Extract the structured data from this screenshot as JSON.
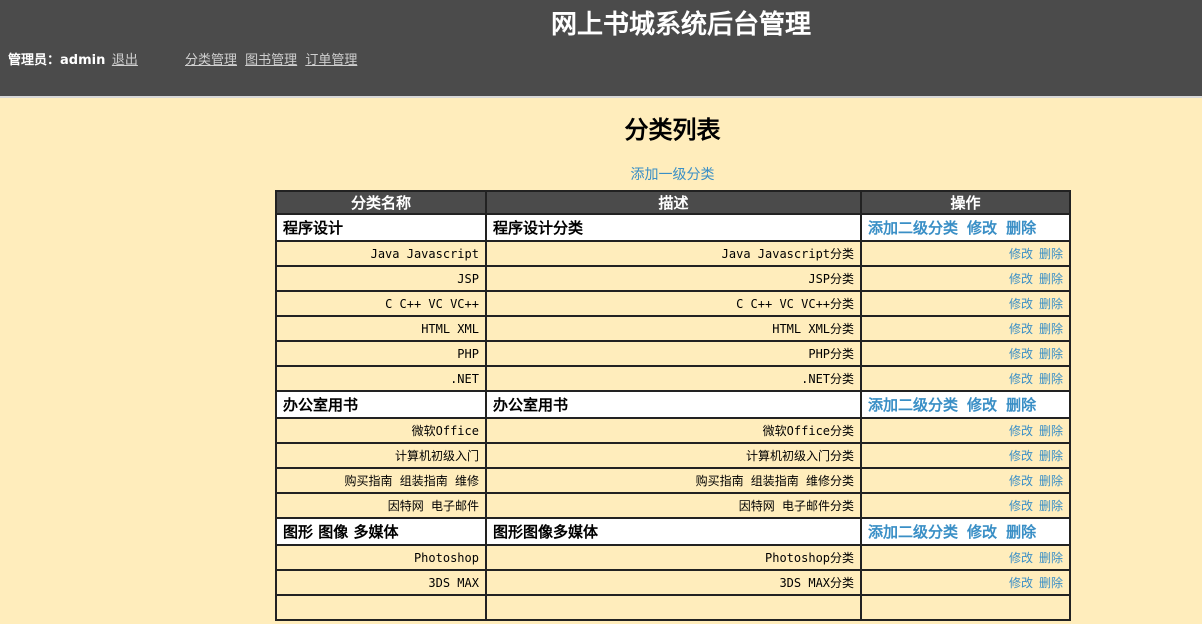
{
  "header": {
    "title": "网上书城系统后台管理",
    "admin_label": "管理员：admin",
    "logout": "退出",
    "nav": [
      "分类管理",
      "图书管理",
      "订单管理"
    ]
  },
  "main": {
    "title": "分类列表",
    "add_top_link": "添加一级分类",
    "columns": [
      "分类名称",
      "描述",
      "操作"
    ],
    "ops": {
      "add_child": "添加二级分类",
      "edit": "修改",
      "delete": "删除"
    },
    "rows": [
      {
        "level": 1,
        "name": "程序设计",
        "desc": "程序设计分类"
      },
      {
        "level": 2,
        "name": "Java Javascript",
        "desc": "Java Javascript分类"
      },
      {
        "level": 2,
        "name": "JSP",
        "desc": "JSP分类"
      },
      {
        "level": 2,
        "name": "C C++ VC VC++",
        "desc": "C C++ VC VC++分类"
      },
      {
        "level": 2,
        "name": "HTML XML",
        "desc": "HTML XML分类"
      },
      {
        "level": 2,
        "name": "PHP",
        "desc": "PHP分类"
      },
      {
        "level": 2,
        "name": ".NET",
        "desc": ".NET分类"
      },
      {
        "level": 1,
        "name": "办公室用书",
        "desc": "办公室用书"
      },
      {
        "level": 2,
        "name": "微软Office",
        "desc": "微软Office分类"
      },
      {
        "level": 2,
        "name": "计算机初级入门",
        "desc": "计算机初级入门分类"
      },
      {
        "level": 2,
        "name": "购买指南 组装指南 维修",
        "desc": "购买指南 组装指南 维修分类"
      },
      {
        "level": 2,
        "name": "因特网 电子邮件",
        "desc": "因特网 电子邮件分类"
      },
      {
        "level": 1,
        "name": "图形 图像 多媒体",
        "desc": "图形图像多媒体"
      },
      {
        "level": 2,
        "name": "Photoshop",
        "desc": "Photoshop分类"
      },
      {
        "level": 2,
        "name": "3DS MAX",
        "desc": "3DS MAX分类"
      },
      {
        "level": 2,
        "name": "",
        "desc": ""
      }
    ]
  },
  "colors": {
    "header_bg": "#4b4b4b",
    "page_bg": "#ffedbc",
    "link": "#3a8fc6"
  }
}
